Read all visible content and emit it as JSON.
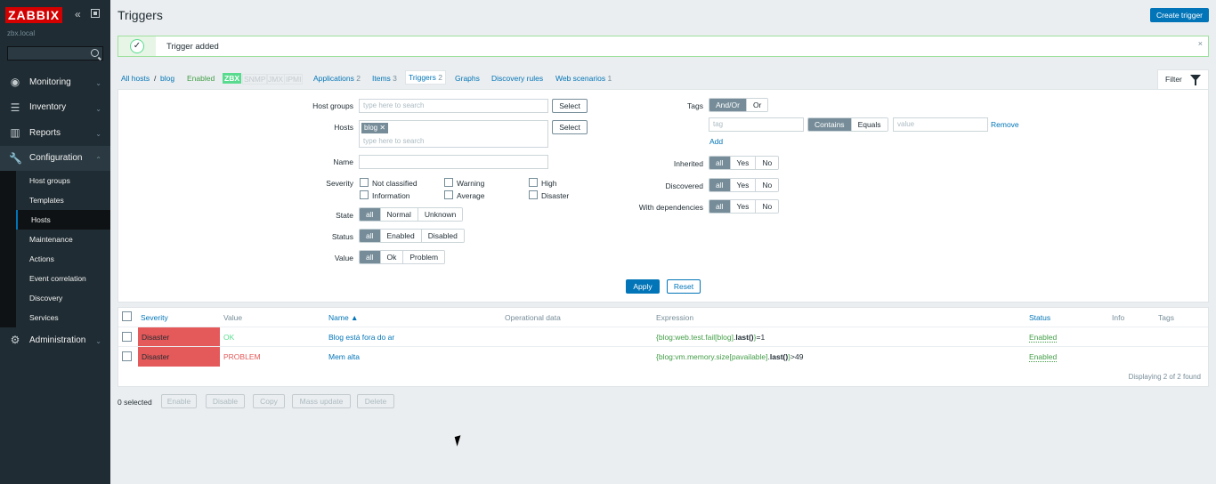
{
  "sidebar": {
    "logo": "ZABBIX",
    "collapse_icon": "double-chevron-left-icon",
    "server_name": "zbx.local",
    "menu": [
      {
        "label": "Monitoring",
        "icon": "eye-icon"
      },
      {
        "label": "Inventory",
        "icon": "list-icon"
      },
      {
        "label": "Reports",
        "icon": "bar-chart-icon"
      },
      {
        "label": "Configuration",
        "icon": "wrench-icon"
      },
      {
        "label": "Administration",
        "icon": "gear-icon"
      }
    ],
    "submenu": [
      "Host groups",
      "Templates",
      "Hosts",
      "Maintenance",
      "Actions",
      "Event correlation",
      "Discovery",
      "Services"
    ]
  },
  "header": {
    "title": "Triggers",
    "create_button": "Create trigger"
  },
  "message": {
    "text": "Trigger added",
    "close": "×"
  },
  "nav": {
    "all_hosts": "All hosts",
    "sep": "/",
    "host": "blog",
    "enabled": "Enabled",
    "zbx": "ZBX",
    "snmp": "SNMP",
    "jmx": "JMX",
    "ipmi": "IPMI",
    "applications": "Applications",
    "applications_count": "2",
    "items": "Items",
    "items_count": "3",
    "triggers": "Triggers",
    "triggers_count": "2",
    "graphs": "Graphs",
    "discovery_rules": "Discovery rules",
    "web_scenarios": "Web scenarios",
    "web_scenarios_count": "1",
    "filter": "Filter"
  },
  "filter": {
    "host_groups_label": "Host groups",
    "host_groups_placeholder": "type here to search",
    "select": "Select",
    "hosts_label": "Hosts",
    "hosts_chip": "blog",
    "hosts_placeholder": "type here to search",
    "name_label": "Name",
    "severity_label": "Severity",
    "severities": [
      "Not classified",
      "Warning",
      "High",
      "Information",
      "Average",
      "Disaster"
    ],
    "state_label": "State",
    "state_options": [
      "all",
      "Normal",
      "Unknown"
    ],
    "status_label": "Status",
    "status_options": [
      "all",
      "Enabled",
      "Disabled"
    ],
    "value_label": "Value",
    "value_options": [
      "all",
      "Ok",
      "Problem"
    ],
    "tags_label": "Tags",
    "tags_options": [
      "And/Or",
      "Or"
    ],
    "tag_placeholder": "tag",
    "tag_ops": [
      "Contains",
      "Equals"
    ],
    "value_placeholder": "value",
    "remove": "Remove",
    "add": "Add",
    "inherited_label": "Inherited",
    "discovered_label": "Discovered",
    "dependencies_label": "With dependencies",
    "yn_options": [
      "all",
      "Yes",
      "No"
    ],
    "apply": "Apply",
    "reset": "Reset"
  },
  "table": {
    "headers": {
      "severity": "Severity",
      "value": "Value",
      "name": "Name ▲",
      "opdata": "Operational data",
      "expression": "Expression",
      "status": "Status",
      "info": "Info",
      "tags": "Tags"
    },
    "rows": [
      {
        "severity": "Disaster",
        "value": "OK",
        "name": "Blog está fora do ar",
        "expr_key": "{blog:web.test.fail[blog]",
        "expr_dot": ".",
        "expr_func": "last()",
        "expr_close": "}",
        "expr_rest": "=1",
        "status": "Enabled"
      },
      {
        "severity": "Disaster",
        "value": "PROBLEM",
        "name": "Mem alta",
        "expr_key": "{blog:vm.memory.size[pavailable]",
        "expr_dot": ".",
        "expr_func": "last()",
        "expr_close": "}",
        "expr_rest": ">49",
        "status": "Enabled"
      }
    ],
    "footer": "Displaying 2 of 2 found"
  },
  "actions": {
    "selected": "0 selected",
    "buttons": [
      "Enable",
      "Disable",
      "Copy",
      "Mass update",
      "Delete"
    ]
  },
  "colors": {
    "sidebar": "#1f2c33",
    "accent": "#0275b8",
    "disaster": "#e45959",
    "ok": "#59db8f",
    "logo": "#d40000"
  }
}
